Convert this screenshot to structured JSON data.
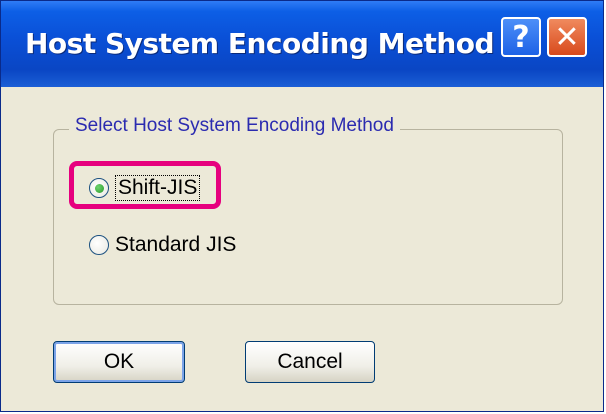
{
  "window": {
    "title": "Host System Encoding Method",
    "help_glyph": "?",
    "close_glyph": "✕"
  },
  "group": {
    "legend": "Select Host System Encoding Method"
  },
  "options": [
    {
      "label": "Shift-JIS",
      "selected": true
    },
    {
      "label": "Standard JIS",
      "selected": false
    }
  ],
  "buttons": {
    "ok": "OK",
    "cancel": "Cancel"
  },
  "colors": {
    "highlight": "#e6007e",
    "title_bar": "#0a4fd6"
  },
  "icons": {
    "help": "help-icon",
    "close": "close-icon"
  }
}
